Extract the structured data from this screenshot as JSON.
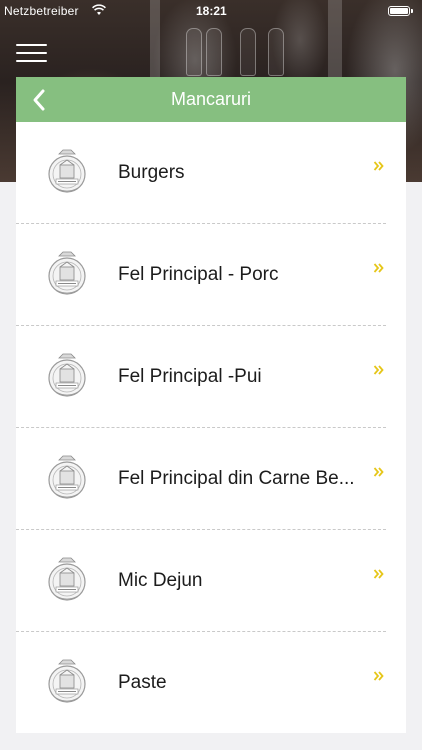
{
  "status_bar": {
    "carrier": "Netzbetreiber",
    "time": "18:21",
    "wifi_icon": "wifi-icon",
    "battery_icon": "battery-full-icon"
  },
  "nav": {
    "menu_icon": "hamburger-menu-icon",
    "back_icon": "chevron-left-icon",
    "title": "Mancaruri",
    "header_color": "#86bf80"
  },
  "categories": [
    {
      "label": "Burgers",
      "thumbnail_icon": "restaurant-logo-icon",
      "arrow_icon": "double-chevron-right-icon"
    },
    {
      "label": "Fel Principal - Porc",
      "thumbnail_icon": "restaurant-logo-icon",
      "arrow_icon": "double-chevron-right-icon"
    },
    {
      "label": "Fel Principal -Pui",
      "thumbnail_icon": "restaurant-logo-icon",
      "arrow_icon": "double-chevron-right-icon"
    },
    {
      "label": "Fel Principal din Carne Be...",
      "thumbnail_icon": "restaurant-logo-icon",
      "arrow_icon": "double-chevron-right-icon"
    },
    {
      "label": "Mic Dejun",
      "thumbnail_icon": "restaurant-logo-icon",
      "arrow_icon": "double-chevron-right-icon"
    },
    {
      "label": "Paste",
      "thumbnail_icon": "restaurant-logo-icon",
      "arrow_icon": "double-chevron-right-icon"
    }
  ],
  "colors": {
    "accent_arrow": "#e6c619",
    "background": "#f1f1f3"
  }
}
